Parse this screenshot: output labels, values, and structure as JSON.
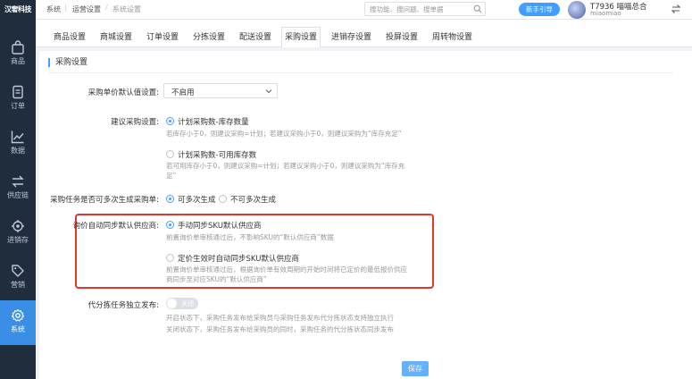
{
  "header": {
    "logo": "汉奢科技",
    "breadcrumb": [
      "系统",
      "运营设置",
      "系统设置"
    ],
    "search_placeholder": "搜功能、搜问题、搜单据",
    "guide_button": "新手引导",
    "user_name": "T7936 喵喵总合",
    "user_sub": "miaomiao",
    "icons": [
      "search-icon",
      "switch-icon"
    ]
  },
  "sidebar": {
    "items": [
      {
        "label": "商品",
        "icon": "bag-icon",
        "active": false
      },
      {
        "label": "订单",
        "icon": "document-icon",
        "active": false
      },
      {
        "label": "数据",
        "icon": "chart-line-icon",
        "active": false
      },
      {
        "label": "供应链",
        "icon": "exchange-icon",
        "active": false
      },
      {
        "label": "进销存",
        "icon": "gear-cluster-icon",
        "active": false
      },
      {
        "label": "营销",
        "icon": "tag-icon",
        "active": false
      },
      {
        "label": "系统",
        "icon": "settings-icon",
        "active": true
      }
    ]
  },
  "tabs": [
    "商品设置",
    "商城设置",
    "订单设置",
    "分拣设置",
    "配送设置",
    "采购设置",
    "进销存设置",
    "投屏设置",
    "周转物设置"
  ],
  "active_tab": "采购设置",
  "form": {
    "section_title": "采购设置",
    "unit_price_label": "采购单价默认值设置:",
    "unit_price_value": "不启用",
    "suggest_label": "建议采购设置:",
    "suggest_opt1": "计划采购数-库存数量",
    "suggest_opt1_hint": "若库存小于0，则建议采购=计划；若建议采购小于0，则建议采购为“库存充足”",
    "suggest_opt2": "计划采购数-可用库存数",
    "suggest_opt2_hint_1": "若可用库存小于0，则建议采购=计划；若建议采购小于0，则建议采购为“库存充",
    "suggest_opt2_hint_2": "足”",
    "multi_label": "采购任务是否可多次生成采购单:",
    "multi_opt_yes": "可多次生成",
    "multi_opt_no": "不可多次生成",
    "inquiry_label": "询价自动同步默认供应商:",
    "inquiry_opt1": "手动同步SKU默认供应商",
    "inquiry_opt1_hint": "前置询价单审核通过后，不影响SKU的“默认供应商”数据",
    "inquiry_opt2": "定价生效时自动同步SKU默认供应商",
    "inquiry_opt2_hint_1": "前置询价单审核通过后，根据询价单有效周期的开始时间将已定价的最低报价供应",
    "inquiry_opt2_hint_2": "商同步至对应SKU的“默认供应商”",
    "agency_label": "代分拣任务独立发布:",
    "toggle_label": "关闭",
    "agency_hint_1": "开启状态下，采购任务发布给采购员与采购任务发布代分拣状态支持独立执行",
    "agency_hint_2": "关闭状态下，采购任务发布给采购员的同时，采购任务的代分拣状态同步发布",
    "save_button": "保存"
  },
  "colors": {
    "accent": "#409eff",
    "highlight_border": "#e0372b",
    "sidebar_bg": "#1f2d3d"
  }
}
